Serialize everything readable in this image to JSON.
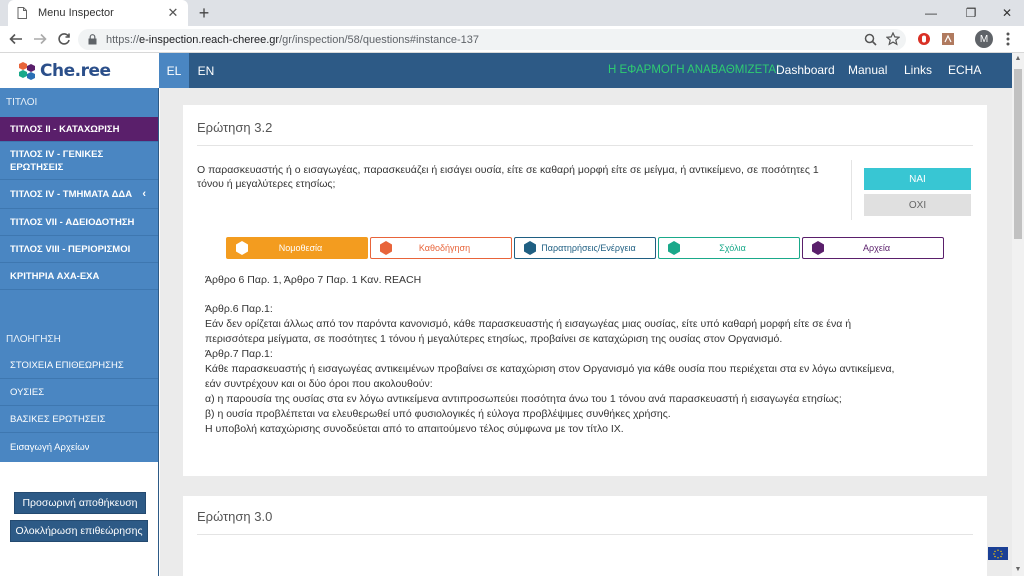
{
  "browser": {
    "tab_title": "Menu Inspector",
    "tab_close": "✕",
    "new_tab": "+",
    "url_prefix": "https://",
    "url_host": "e-inspection.reach-cheree.gr",
    "url_path": "/gr/inspection/58/questions#instance-137",
    "profile_initial": "M",
    "window_controls": {
      "minimize": "—",
      "maximize": "❐",
      "close": "✕"
    }
  },
  "header": {
    "logo_text": "Che.ree",
    "languages": [
      {
        "label": "EL",
        "active": true
      },
      {
        "label": "EN",
        "active": false
      }
    ],
    "upgrade_note": "Η ΕΦΑΡΜΟΓΗ ΑΝΑΒΑΘΜΙΖΕΤΑΙ",
    "nav": [
      "Dashboard",
      "Manual",
      "Links",
      "ECHA"
    ]
  },
  "sidebar": {
    "titles_heading": "ΤΙΤΛΟΙ",
    "title_items": [
      {
        "label": "ΤΙΤΛΟΣ ΙΙ - ΚΑΤΑΧΩΡΙΣΗ",
        "active": true
      },
      {
        "label": "ΤΙΤΛΟΣ IV - ΓΕΝΙΚΕΣ ΕΡΩΤΗΣΕΙΣ",
        "active": false
      },
      {
        "label": "ΤΙΤΛΟΣ IV - ΤΜΗΜΑΤΑ ΔΔΑ",
        "active": false,
        "chevron": "‹"
      },
      {
        "label": "ΤΙΤΛΟΣ VII - ΑΔΕΙΟΔΟΤΗΣΗ",
        "active": false
      },
      {
        "label": "ΤΙΤΛΟΣ VIII - ΠΕΡΙΟΡΙΣΜΟΙ",
        "active": false
      },
      {
        "label": "ΚΡΙΤΗΡΙΑ ΑΧΑ-ΕΧΑ",
        "active": false
      }
    ],
    "nav_heading": "ΠΛΟΗΓΗΣΗ",
    "nav_items": [
      "ΣΤΟΙΧΕΙΑ ΕΠΙΘΕΩΡΗΣΗΣ",
      "ΟΥΣΙΕΣ",
      "ΒΑΣΙΚΕΣ ΕΡΩΤΗΣΕΙΣ",
      "Εισαγωγή Αρχείων"
    ],
    "save_temp": "Προσωρινή αποθήκευση",
    "complete": "Ολοκλήρωση επιθεώρησης"
  },
  "question": {
    "title": "Ερώτηση 3.2",
    "text": "Ο παρασκευαστής ή ο εισαγωγέας, παρασκευάζει ή εισάγει ουσία, είτε σε καθαρή μορφή είτε σε μείγμα, ή αντικείμενο, σε ποσότητες 1 τόνου ή μεγαλύτερες ετησίως;",
    "yes": "ΝΑΙ",
    "no": "ΟΧΙ",
    "tabs": [
      {
        "label": "Νομοθεσία",
        "color": "#f39c1f",
        "active": true
      },
      {
        "label": "Καθοδήγηση",
        "color": "#e8643a",
        "active": false
      },
      {
        "label": "Παρατηρήσεις/Ενέργεια",
        "color": "#1f5f82",
        "active": false
      },
      {
        "label": "Σχόλια",
        "color": "#1aa98a",
        "active": false
      },
      {
        "label": "Αρχεία",
        "color": "#5a1f6b",
        "active": false
      }
    ],
    "article_title": "Άρθρο 6 Παρ. 1, Άρθρο 7 Παρ. 1 Καν. REACH",
    "article_lines": [
      "Άρθρ.6 Παρ.1:",
      "Εάν δεν ορίζεται άλλως από τον παρόντα κανονισμό, κάθε παρασκευαστής ή εισαγωγέας μιας ουσίας, είτε υπό καθαρή μορφή είτε σε ένα ή",
      "περισσότερα μείγματα, σε ποσότητες 1 τόνου ή μεγαλύτερες ετησίως, προβαίνει σε καταχώριση της ουσίας στον Οργανισμό.",
      "Άρθρ.7 Παρ.1:",
      "Κάθε παρασκευαστής ή εισαγωγέας αντικειμένων προβαίνει σε καταχώριση στον Οργανισμό για κάθε ουσία που περιέχεται στα εν λόγω αντικείμενα,",
      "εάν συντρέχουν και οι δύο όροι που ακολουθούν:",
      "α) η παρουσία της ουσίας στα εν λόγω αντικείμενα αντιπροσωπεύει ποσότητα άνω του 1 τόνου ανά παρασκευαστή ή εισαγωγέα ετησίως;",
      "β) η ουσία προβλέπεται να ελευθερωθεί υπό φυσιολογικές ή εύλογα προβλέψιμες συνθήκες χρήσης.",
      "Η υποβολή καταχώρισης συνοδεύεται από το απαιτούμενο τέλος σύμφωνα με τον τίτλο ΙΧ."
    ]
  },
  "next_question": {
    "title": "Ερώτηση 3.0"
  },
  "colors": {
    "header": "#2d5a86",
    "sidebar": "#4a86c2",
    "active_item": "#5a1f6b",
    "yes_button": "#38c6d3"
  }
}
